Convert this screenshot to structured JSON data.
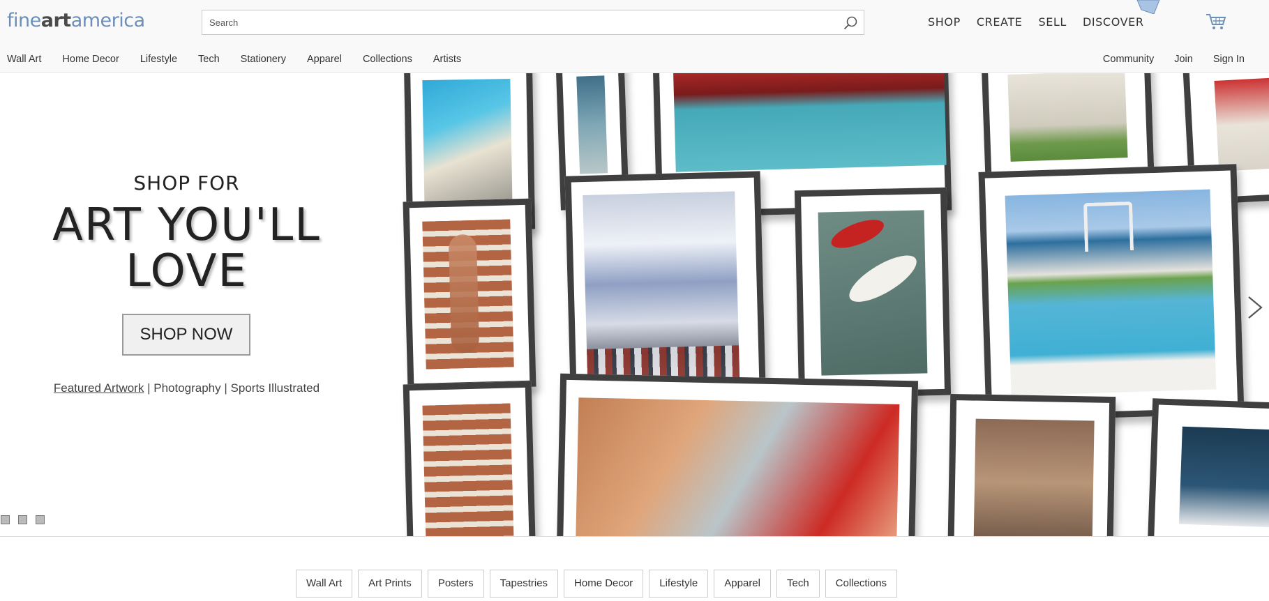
{
  "header": {
    "logo": {
      "part1": "fine",
      "part2": "art",
      "part3": "america"
    },
    "search_placeholder": "Search",
    "main_nav": [
      "SHOP",
      "CREATE",
      "SELL",
      "DISCOVER"
    ],
    "sub_nav": [
      "Wall Art",
      "Home Decor",
      "Lifestyle",
      "Tech",
      "Stationery",
      "Apparel",
      "Collections",
      "Artists"
    ],
    "account_nav": [
      "Community",
      "Join",
      "Sign In"
    ]
  },
  "hero": {
    "kicker": "SHOP FOR",
    "headline_line1": "ART YOU'LL",
    "headline_line2": "LOVE",
    "button": "SHOP NOW",
    "link1": "Featured Artwork",
    "link2": "Photography",
    "link3": "Sports Illustrated",
    "separator": "|"
  },
  "categories": [
    "Wall Art",
    "Art Prints",
    "Posters",
    "Tapestries",
    "Home Decor",
    "Lifestyle",
    "Apparel",
    "Tech",
    "Collections"
  ],
  "colors": {
    "logo_blue": "#6b8fb8",
    "frame": "#3f3f3f",
    "brand_dark": "#4a4a4a"
  }
}
